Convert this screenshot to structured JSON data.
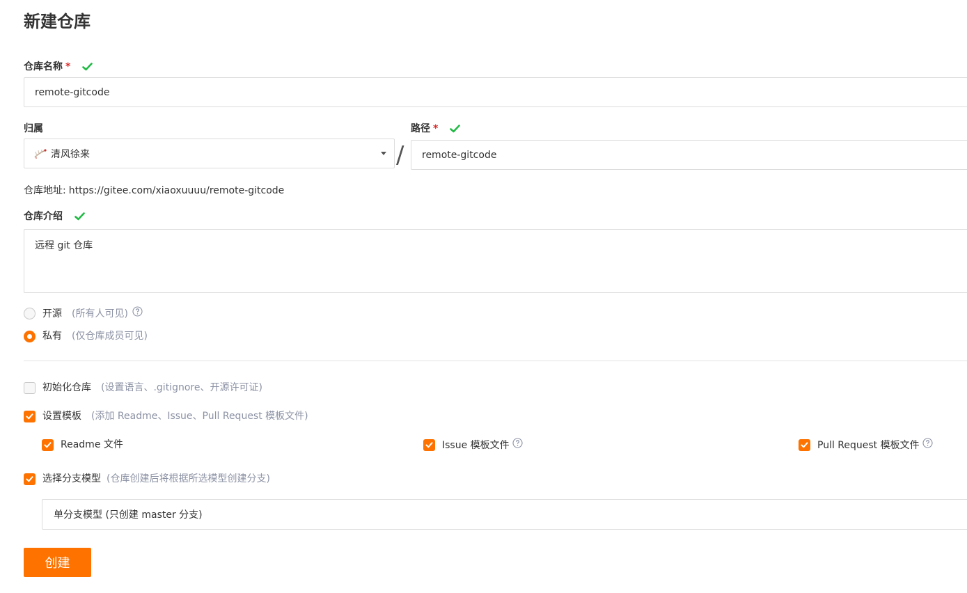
{
  "page": {
    "title": "新建仓库"
  },
  "repo_name": {
    "label": "仓库名称",
    "required_mark": "*",
    "value": "remote-gitcode"
  },
  "owner": {
    "label": "归属",
    "value": "清风徐来"
  },
  "separator": "/",
  "path": {
    "label": "路径",
    "required_mark": "*",
    "value": "remote-gitcode"
  },
  "address": {
    "label": "仓库地址:",
    "url": "https://gitee.com/xiaoxuuuu/remote-gitcode"
  },
  "intro": {
    "label": "仓库介绍",
    "value": "远程 git 仓库"
  },
  "visibility": {
    "selected": "private",
    "options": [
      {
        "label": "开源",
        "hint": "(所有人可见)"
      },
      {
        "label": "私有",
        "hint": "(仅仓库成员可见)"
      }
    ]
  },
  "init_repo": {
    "label": "初始化仓库",
    "hint": "(设置语言、.gitignore、开源许可证)",
    "checked": false
  },
  "templates": {
    "label": "设置模板",
    "hint": "(添加 Readme、Issue、Pull Request 模板文件)",
    "checked": true,
    "options": [
      {
        "label": "Readme 文件",
        "checked": true
      },
      {
        "label": "Issue 模板文件",
        "checked": true
      },
      {
        "label": "Pull Request 模板文件",
        "checked": true
      }
    ]
  },
  "branch_model": {
    "label": "选择分支模型",
    "hint": "(仓库创建后将根据所选模型创建分支)",
    "checked": true,
    "value": "单分支模型 (只创建 master 分支)"
  },
  "create_button": {
    "label": "创建"
  },
  "colors": {
    "accent": "#fe7300",
    "success": "#21ba45",
    "required": "#db2828",
    "muted": "#8c92a4",
    "border": "#dcdcdc"
  },
  "icons": {
    "valid": "check-icon",
    "help": "question-circle-icon",
    "dropdown": "caret-down-icon"
  }
}
